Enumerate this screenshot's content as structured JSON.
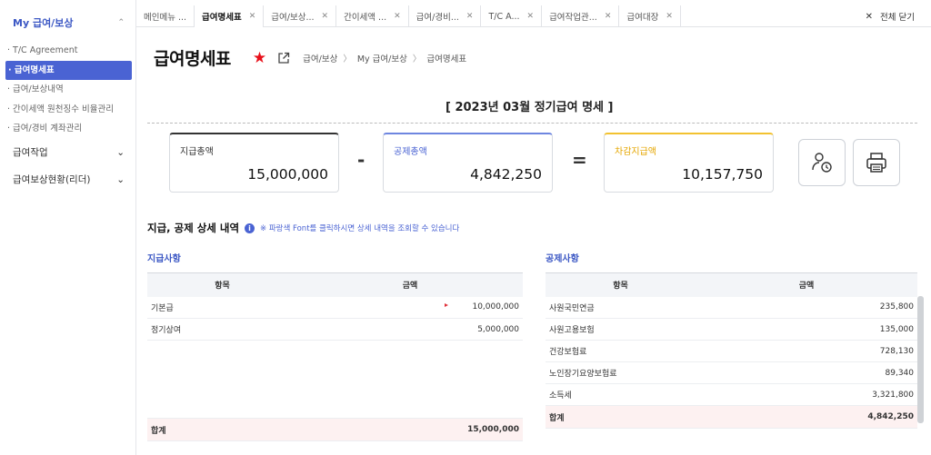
{
  "sidebar": {
    "group_active": "My 급여/보상",
    "items": [
      {
        "label": "T/C Agreement"
      },
      {
        "label": "급여명세표"
      },
      {
        "label": "급여/보상내역"
      },
      {
        "label": "간이세액 원천징수 비율관리"
      },
      {
        "label": "급여/경비 계좌관리"
      }
    ],
    "groups": [
      {
        "label": "급여작업"
      },
      {
        "label": "급여보상현황(리더)"
      }
    ]
  },
  "tabs": [
    {
      "label": "메인메뉴 ..."
    },
    {
      "label": "급여명세표"
    },
    {
      "label": "급여/보상..."
    },
    {
      "label": "간이세액 ..."
    },
    {
      "label": "급여/경비..."
    },
    {
      "label": "T/C A..."
    },
    {
      "label": "급여작업관..."
    },
    {
      "label": "급여대장"
    }
  ],
  "close_all_label": "전체 닫기",
  "page": {
    "title": "급여명세표",
    "breadcrumb": [
      "급여/보상",
      "My 급여/보상",
      "급여명세표"
    ],
    "period_title": "[ 2023년 03월 정기급여 명세 ]"
  },
  "summary": {
    "gross_label": "지급총액",
    "gross_value": "15,000,000",
    "minus": "-",
    "deduct_label": "공제총액",
    "deduct_value": "4,842,250",
    "equals": "=",
    "net_label": "차감지급액",
    "net_value": "10,157,750"
  },
  "detail": {
    "title": "지급, 공제 상세 내역",
    "note": "※ 파랑색 Font를 클릭하시면 상세 내역을 조회할 수 있습니다"
  },
  "payments": {
    "title": "지급사항",
    "headers": [
      "항목",
      "금액"
    ],
    "rows": [
      {
        "item": "기본급",
        "amount": "10,000,000"
      },
      {
        "item": "정기상여",
        "amount": "5,000,000"
      }
    ],
    "total_label": "합계",
    "total": "15,000,000"
  },
  "deductions": {
    "title": "공제사항",
    "headers": [
      "항목",
      "금액"
    ],
    "rows": [
      {
        "item": "사원국민연금",
        "amount": "235,800"
      },
      {
        "item": "사원고용보험",
        "amount": "135,000"
      },
      {
        "item": "건강보험료",
        "amount": "728,130"
      },
      {
        "item": "노인장기요양보험료",
        "amount": "89,340"
      },
      {
        "item": "소득세",
        "amount": "3,321,800"
      }
    ],
    "total_label": "합계",
    "total": "4,842,250"
  },
  "colors": {
    "accent": "#4a63d3",
    "favorite": "#e8101a",
    "net_accent": "#f2c230"
  }
}
